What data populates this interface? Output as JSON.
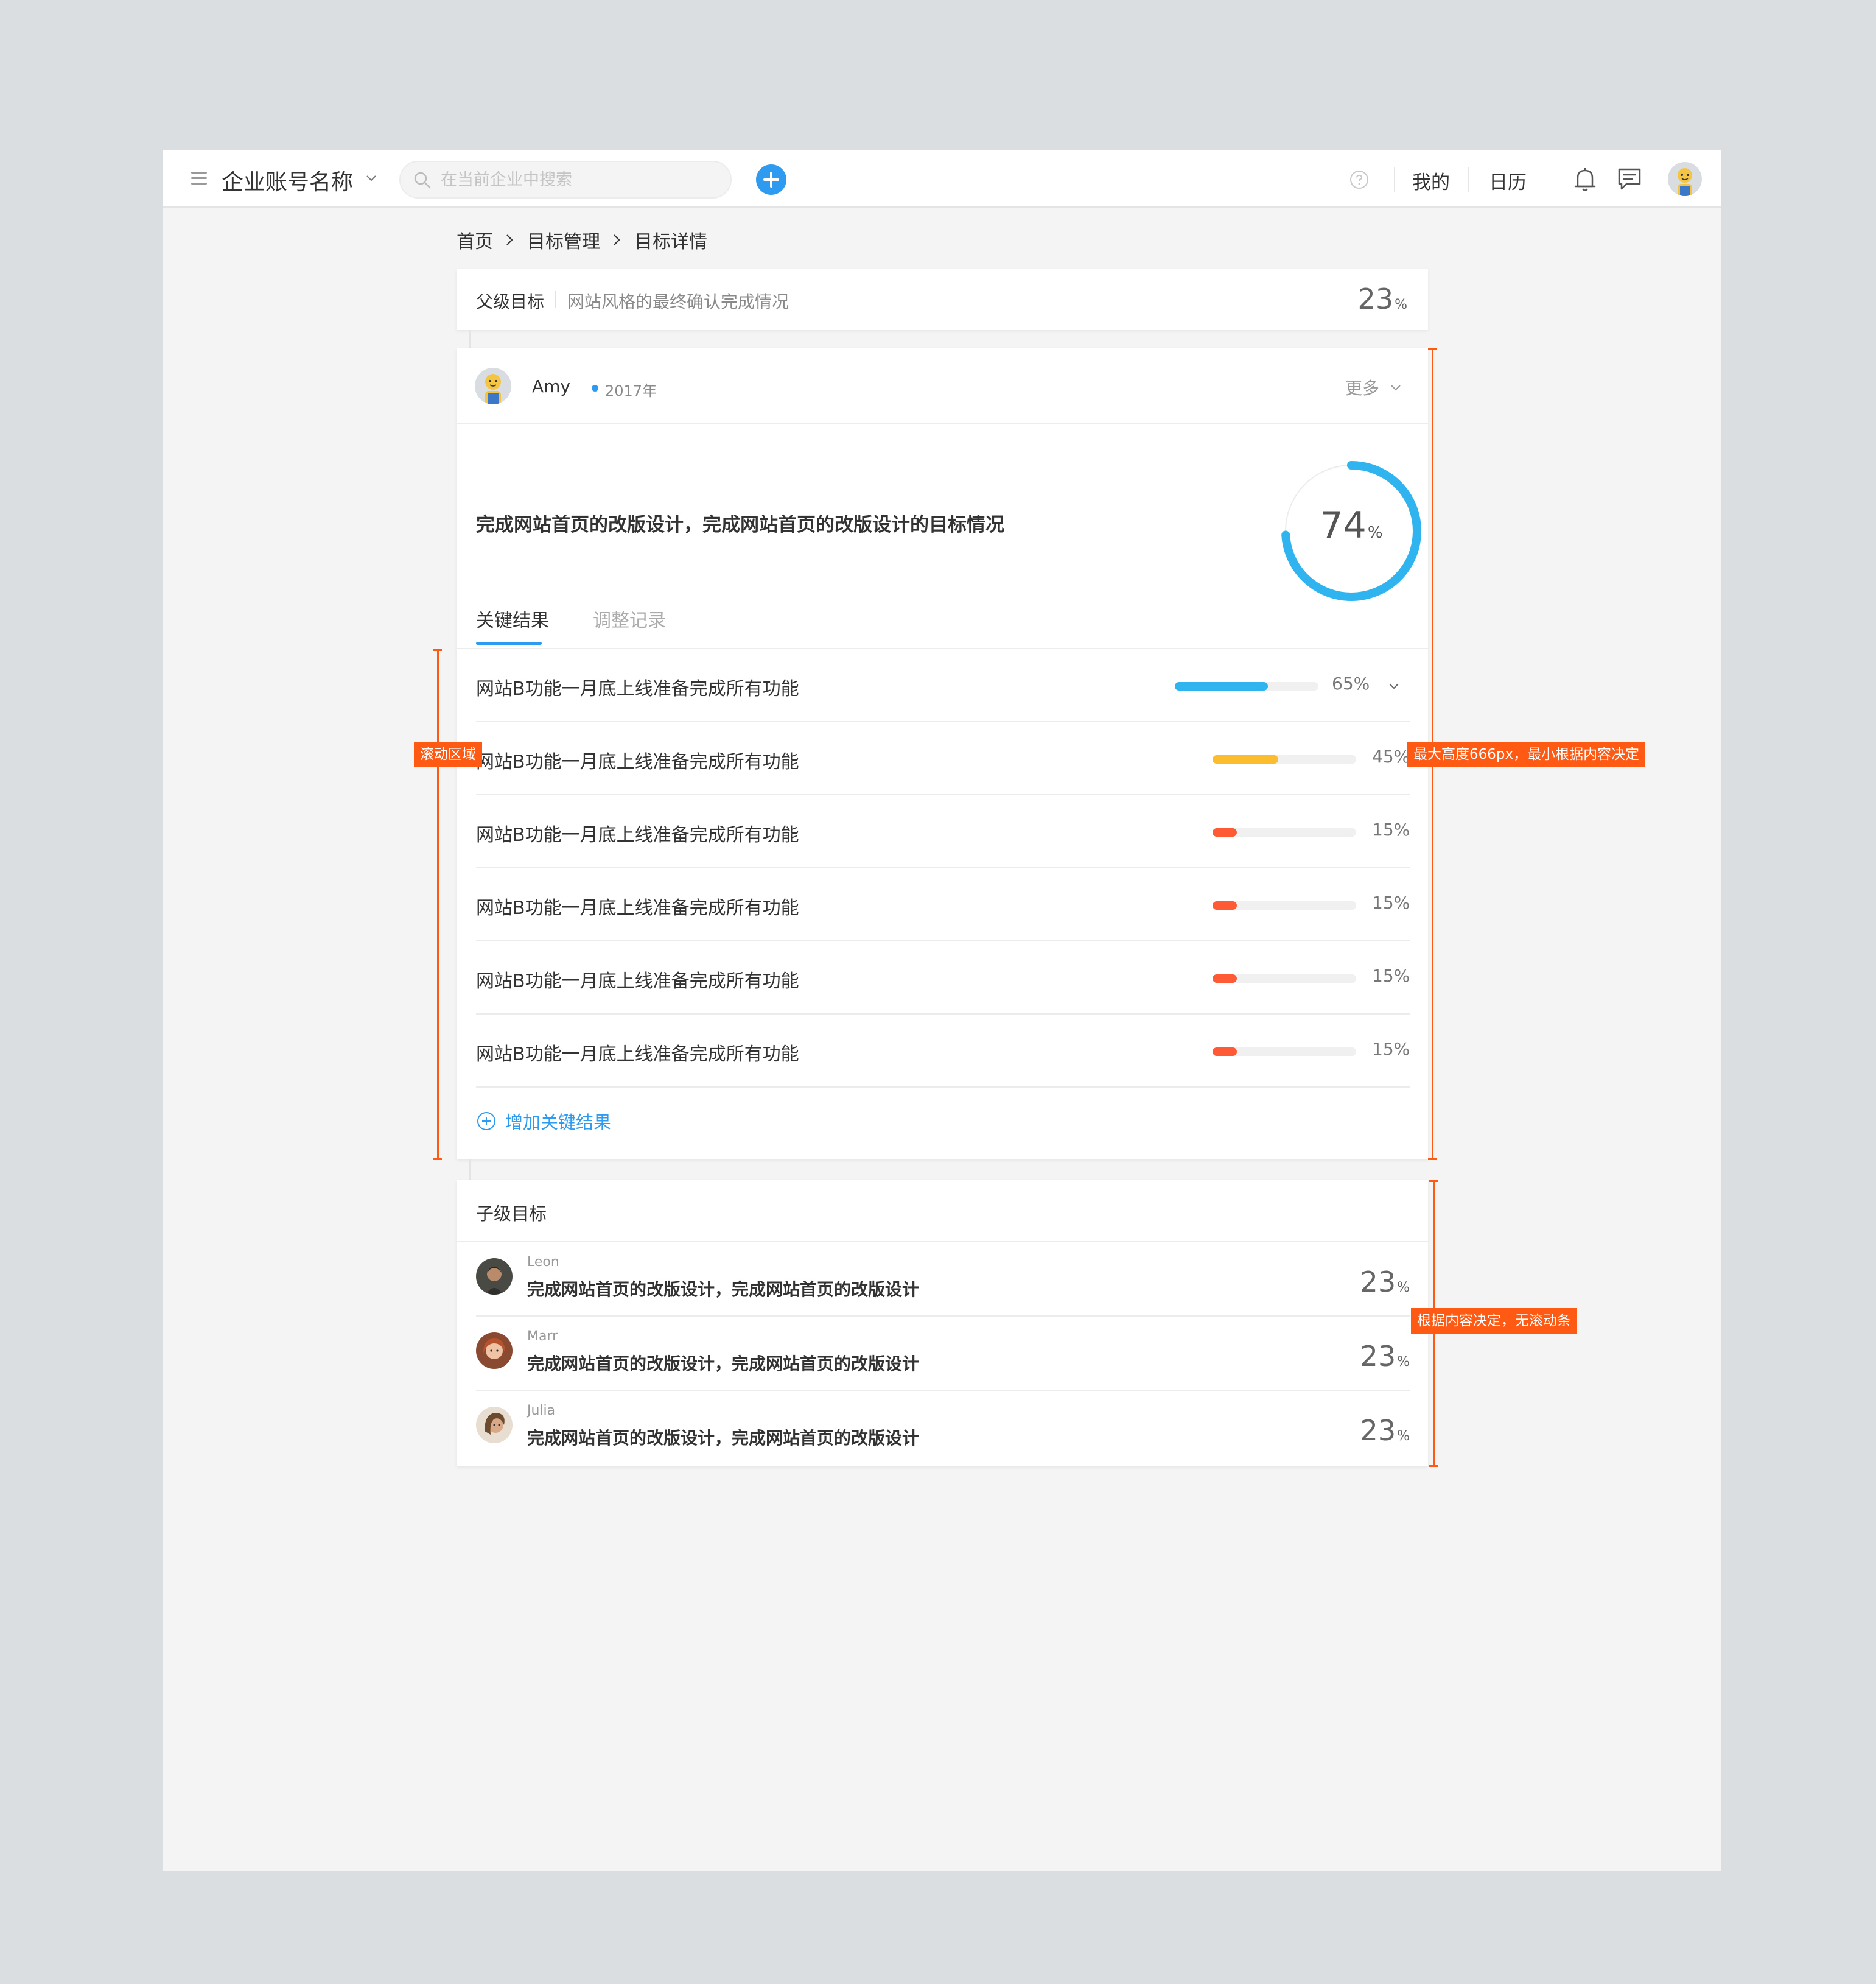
{
  "topbar": {
    "company_name": "企业账号名称",
    "search_placeholder": "在当前企业中搜索",
    "nav_mine": "我的",
    "nav_calendar": "日历"
  },
  "breadcrumb": [
    "首页",
    "目标管理",
    "目标详情"
  ],
  "parent_goal": {
    "label": "父级目标",
    "text": "网站风格的最终确认完成情况",
    "percent": "23",
    "unit": "%"
  },
  "objective": {
    "owner": "Amy",
    "year": "2017年",
    "more_label": "更多",
    "title": "完成网站首页的改版设计，完成网站首页的改版设计的目标情况",
    "progress": 74,
    "progress_label": "74",
    "progress_unit": "%",
    "ring_color": "#2fb4f0"
  },
  "tabs": [
    {
      "label": "关键结果",
      "active": true
    },
    {
      "label": "调整记录",
      "active": false
    }
  ],
  "key_results": [
    {
      "title": "网站B功能一月底上线准备完成所有功能",
      "progress": 65,
      "label": "65%",
      "color": "#2fb4f0",
      "expandable": true
    },
    {
      "title": "网站B功能一月底上线准备完成所有功能",
      "progress": 45,
      "label": "45%",
      "color": "#fbbd2e",
      "expandable": false
    },
    {
      "title": "网站B功能一月底上线准备完成所有功能",
      "progress": 15,
      "label": "15%",
      "color": "#ff5a36",
      "expandable": false
    },
    {
      "title": "网站B功能一月底上线准备完成所有功能",
      "progress": 15,
      "label": "15%",
      "color": "#ff5a36",
      "expandable": false
    },
    {
      "title": "网站B功能一月底上线准备完成所有功能",
      "progress": 15,
      "label": "15%",
      "color": "#ff5a36",
      "expandable": false
    },
    {
      "title": "网站B功能一月底上线准备完成所有功能",
      "progress": 15,
      "label": "15%",
      "color": "#ff5a36",
      "expandable": false
    }
  ],
  "add_kr_label": "增加关键结果",
  "child_goals": {
    "header": "子级目标",
    "items": [
      {
        "name": "Leon",
        "title": "完成网站首页的改版设计，完成网站首页的改版设计",
        "percent": "23",
        "unit": "%"
      },
      {
        "name": "Marr",
        "title": "完成网站首页的改版设计，完成网站首页的改版设计",
        "percent": "23",
        "unit": "%"
      },
      {
        "name": "Julia",
        "title": "完成网站首页的改版设计，完成网站首页的改版设计",
        "percent": "23",
        "unit": "%"
      }
    ]
  },
  "annotations": {
    "scroll_area": "滚动区域",
    "max_height": "最大高度666px，最小根据内容决定",
    "no_scroll": "根据内容决定，无滚动条"
  },
  "colors": {
    "accent": "#2e9bf0",
    "annotation": "#ff5a14"
  }
}
